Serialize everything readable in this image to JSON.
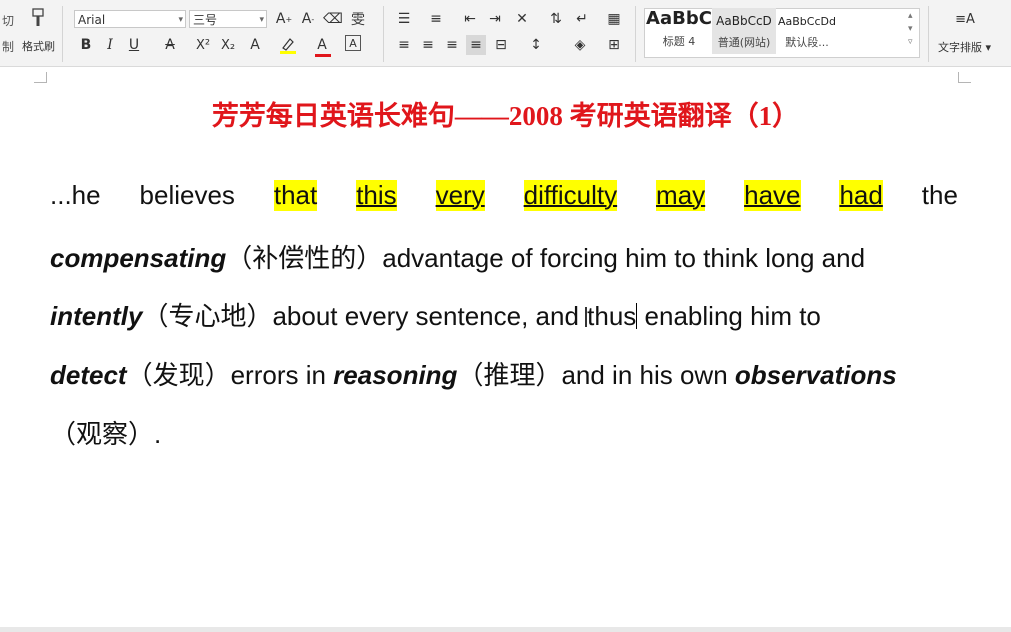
{
  "ribbon": {
    "clipboard": {
      "cut_label": "切",
      "copy_label": "制",
      "format_painter_label": "格式刷"
    },
    "font": {
      "family": "Arial",
      "size": "三号",
      "bold": "B",
      "italic": "I",
      "underline": "U",
      "strikethrough": "A",
      "superscript": "X²",
      "subscript": "X₂",
      "font_color": "A",
      "char_border": "A"
    },
    "styles": [
      {
        "sample": "AaBbC",
        "name": "标题 4"
      },
      {
        "sample": "AaBbCcD",
        "name": "普通(网站)"
      },
      {
        "sample": "AaBbCcDd",
        "name": "默认段..."
      }
    ],
    "text_layout_label": "文字排版"
  },
  "document": {
    "title": "芳芳每日英语长难句——2008 考研英语翻译（1）",
    "line1": {
      "w1": "...he",
      "w2": "believes",
      "hl1": "that",
      "hl2": "this",
      "hl3": "very",
      "hl4": "difficulty",
      "hl5": "may",
      "hl6": "have",
      "hl7": "had",
      "w3": "the"
    },
    "line2": {
      "bi": "compensating",
      "cn": "（补偿性的）",
      "rest": "advantage of forcing him to think long and"
    },
    "line3": {
      "bi": "intently",
      "cn": "（专心地）",
      "rest_a": "about every sentence, and",
      "rest_b": "thus",
      "rest_c": "enabling him to"
    },
    "line4": {
      "bi1": "detect",
      "cn1": "（发现）",
      "t1": "errors in",
      "bi2": "reasoning",
      "cn2": "（推理）",
      "t2": "and in his own",
      "bi3": "observations"
    },
    "line5": {
      "cn": "（观察）",
      "end": "."
    }
  },
  "colors": {
    "title": "#e0161b",
    "highlight": "#ffff00",
    "ribbon_bg": "#f3f3f3"
  }
}
